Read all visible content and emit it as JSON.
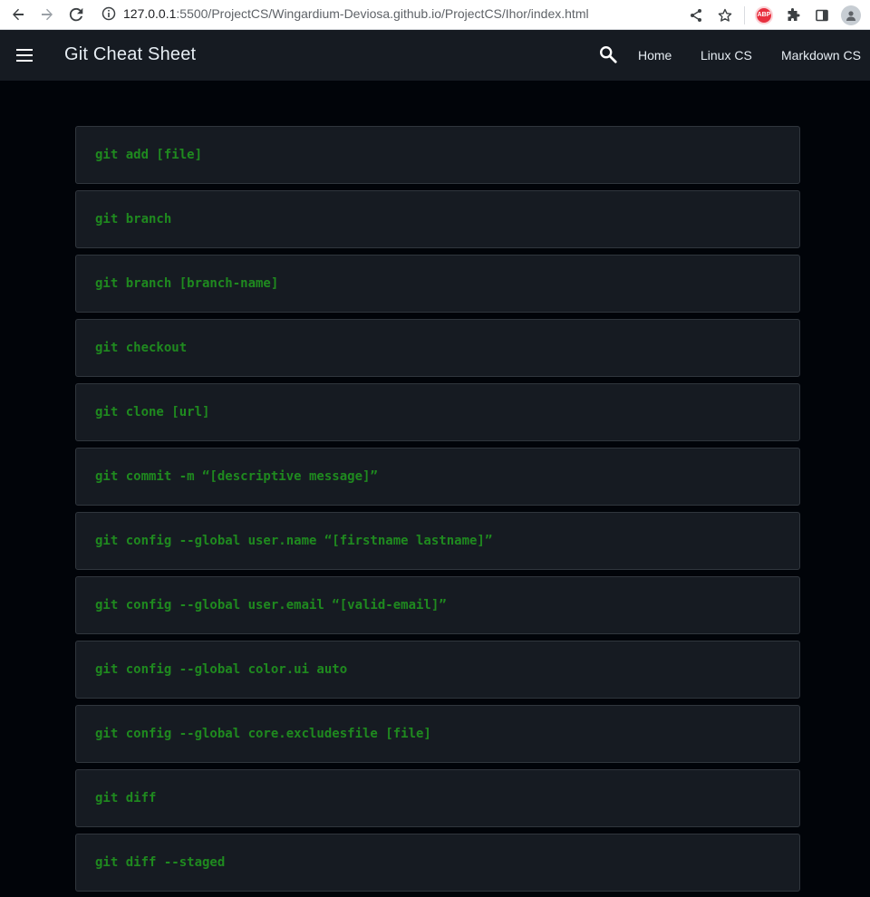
{
  "browser": {
    "url_host": "127.0.0.1",
    "url_rest": ":5500/ProjectCS/Wingardium-Deviosa.github.io/ProjectCS/Ihor/index.html",
    "abp_label": "ABP"
  },
  "header": {
    "title": "Git Cheat Sheet",
    "nav": [
      {
        "label": "Home"
      },
      {
        "label": "Linux CS"
      },
      {
        "label": "Markdown CS"
      }
    ]
  },
  "commands": [
    {
      "text": "git add [file]"
    },
    {
      "text": "git branch"
    },
    {
      "text": "git branch [branch-name]"
    },
    {
      "text": "git checkout"
    },
    {
      "text": "git clone [url]"
    },
    {
      "text": "git commit -m “[descriptive message]”"
    },
    {
      "text": "git config --global user.name “[firstname lastname]”"
    },
    {
      "text": "git config --global user.email “[valid-email]”"
    },
    {
      "text": "git config --global color.ui auto"
    },
    {
      "text": "git config --global core.excludesfile [file]"
    },
    {
      "text": "git diff"
    },
    {
      "text": "git diff --staged"
    }
  ],
  "colors": {
    "header_bg": "#161b22",
    "page_bg": "#010409",
    "command_text": "#1f8a1f"
  }
}
